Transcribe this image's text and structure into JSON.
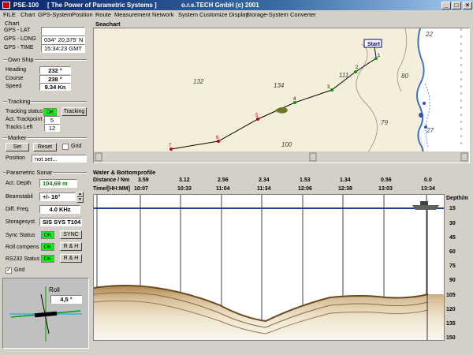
{
  "window": {
    "app_title": "PSE-100",
    "tagline": "[ The Power of Parametric Systems ]",
    "company": "o.r.s.TECH GmbH (c) 2001"
  },
  "menu": [
    "FILE",
    "Chart",
    "GPS-System",
    "Position",
    "Route",
    "Measurement",
    "Network",
    "System",
    "Customize Display",
    "Storage-System",
    "Converter"
  ],
  "chart_group": {
    "title": "Chart",
    "lat_label": "GPS - LAT",
    "lat_value": "",
    "long_label": "GPS - LONG",
    "long_value": "034° 20,375' N",
    "time_label": "GPS - TIME",
    "time_value": "15:34:23 GMT"
  },
  "own_ship": {
    "title": "Own Ship",
    "heading_label": "Heading",
    "heading_value": "232 °",
    "course_label": "Course",
    "course_value": "238 °",
    "speed_label": "Speed",
    "speed_value": "9.34 Kn"
  },
  "tracking": {
    "title": "Tracking",
    "status_label": "Tracking status",
    "status_value": "OK",
    "tracking_button": "Tracking",
    "act_trackpoint_label": "Act. Trackpoint",
    "act_trackpoint_value": "5",
    "tracks_left_label": "Tracks Left",
    "tracks_left_value": "12"
  },
  "marker": {
    "title": "Marker",
    "set_button": "Set",
    "reset_button": "Reset",
    "grid_label": "Grid",
    "position_label": "Position",
    "position_value": "not set..."
  },
  "parametric_sonar": {
    "title": "Parametric Sonar",
    "act_depth_label": "Act. Depth",
    "act_depth_value": "104,69 m",
    "beamstabil_label": "Beamstabil",
    "beamstabil_value": "+/-  16°",
    "diff_freq_label": "Diff. Freq.",
    "diff_freq_value": "4.0 KHz",
    "storagesyst_label": "Storagesyst.",
    "storagesyst_value": "SIS SYS T104",
    "sync_label": "Sync Status",
    "sync_status": "OK",
    "sync_button": "SYNC",
    "roll_label": "Roll compens",
    "roll_status": "OK",
    "roll_button": "R & H",
    "rs232_label": "RS232 Status",
    "rs232_status": "OK",
    "rs232_button": "R & H",
    "grid_label": "Grid",
    "grid_checked": "✓"
  },
  "roll_indicator": {
    "title": "Roll",
    "value": "4,5 °"
  },
  "seachart": {
    "title": "Seachart",
    "start_label": "Start",
    "depth_labels": [
      "132",
      "134",
      "111",
      "80",
      "79",
      "100",
      "22",
      "27"
    ],
    "track_labels": [
      "7",
      "6",
      "5",
      "4",
      "3",
      "2",
      "1"
    ]
  },
  "profile": {
    "title": "Water & Bottomprofile",
    "distance_label": "Distance / Nm",
    "time_label": "Time/[HH:MM]",
    "depth_axis_label": "Depth/m",
    "distances": [
      "3.59",
      "3.12",
      "2.56",
      "2.34",
      "1.53",
      "1.34",
      "0.56",
      "0.0"
    ],
    "times": [
      "10:07",
      "10:33",
      "11:04",
      "11:34",
      "12:06",
      "12:38",
      "13:03",
      "13:34"
    ],
    "depths": [
      "15",
      "30",
      "45",
      "60",
      "75",
      "90",
      "105",
      "120",
      "135",
      "150"
    ]
  }
}
